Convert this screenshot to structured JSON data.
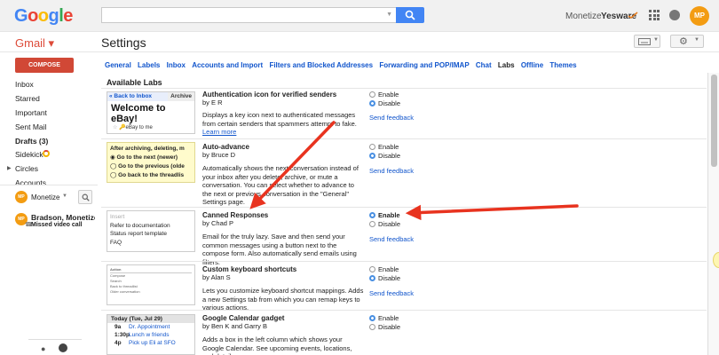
{
  "header": {
    "logo_letters": [
      "G",
      "o",
      "o",
      "g",
      "l",
      "e"
    ],
    "search_placeholder": "",
    "monetize_link": "Monetize",
    "yesware_link": "Yesware",
    "avatar_initials": "MP"
  },
  "app": {
    "gmail_label": "Gmail ▾",
    "page_title": "Settings"
  },
  "sidebar": {
    "compose_label": "COMPOSE",
    "items": [
      "Inbox",
      "Starred",
      "Important",
      "Sent Mail",
      "Drafts (3)",
      "Sidekick",
      "Circles",
      "Accounts"
    ],
    "chat_me": "Monetize",
    "chat_me_initials": "MP",
    "contact_initials": "MP",
    "contact_name": "Bradson, MonetizeF",
    "contact_status": "Missed video call"
  },
  "tabs": [
    "General",
    "Labels",
    "Inbox",
    "Accounts and Import",
    "Filters and Blocked Addresses",
    "Forwarding and POP/IMAP",
    "Chat",
    "Labs",
    "Offline",
    "Themes"
  ],
  "active_tab": "Labs",
  "labs": {
    "heading": "Available Labs",
    "enable_label": "Enable",
    "disable_label": "Disable",
    "feedback_label": "Send feedback",
    "items": [
      {
        "title": "Authentication icon for verified senders",
        "author": "by E R",
        "description": "Displays a key icon next to authenticated messages from certain senders that spammers attempt to fake.",
        "learn_more": "Learn more",
        "state": "disable",
        "thumb": {
          "back": "« Back to Inbox",
          "archive": "Archive",
          "welcome": "Welcome to eBay!",
          "ebay_to": "eBay to me"
        }
      },
      {
        "title": "Auto-advance",
        "author": "by Bruce D",
        "description": "Automatically shows the next conversation instead of your inbox after you delete, archive, or mute a conversation. You can select whether to advance to the next or previous conversation in the \"General\" Settings page.",
        "state": "disable",
        "thumb": {
          "lines": [
            "After archiving, deleting, m",
            "◉ Go to the next (newer)",
            "◯ Go to the previous (olde",
            "◯ Go back to the threadlis"
          ]
        }
      },
      {
        "title": "Canned Responses",
        "author": "by Chad P",
        "description": "Email for the truly lazy. Save and then send your common messages using a button next to the compose form. Also automatically send emails using filters.",
        "state": "enable",
        "thumb": {
          "lines": [
            "Insert",
            "Refer to documentation",
            "Status report template",
            "FAQ"
          ]
        }
      },
      {
        "title": "Custom keyboard shortcuts",
        "author": "by Alan S",
        "description": "Lets you customize keyboard shortcut mappings. Adds a new Settings tab from which you can remap keys to various actions.",
        "state": "disable",
        "thumb": {
          "lines": [
            "Action",
            "Compose",
            "Search",
            "Back to threadlist",
            "Older conversation"
          ]
        }
      },
      {
        "title": "Google Calendar gadget",
        "author": "by Ben K and Garry B",
        "description": "Adds a box in the left column which shows your Google Calendar. See upcoming events, locations, and details.",
        "state": "enable",
        "thumb": {
          "head": "Today (Tue, Jul 29)",
          "events": [
            {
              "time": "9a",
              "title": "Dr. Appointment"
            },
            {
              "time": "1:30p",
              "title": "Lunch w friends"
            },
            {
              "time": "4p",
              "title": "Pick up Eli at SFO"
            }
          ]
        }
      }
    ]
  },
  "colors": {
    "accent_red": "#d14836",
    "link_blue": "#1155cc",
    "arrow_red": "#e8331f",
    "search_blue": "#4285f4"
  }
}
